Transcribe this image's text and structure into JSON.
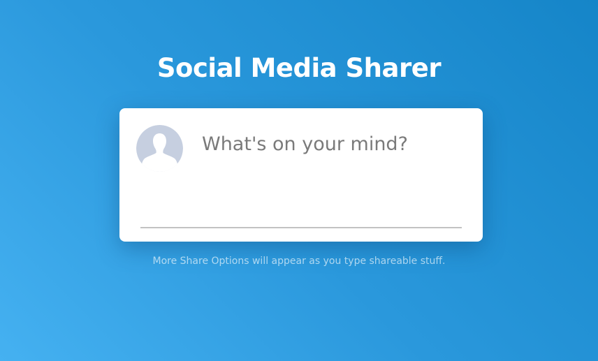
{
  "header": {
    "title": "Social Media Sharer"
  },
  "composer": {
    "placeholder": "What's on your mind?",
    "value": "",
    "avatar_icon": "default-user-silhouette-icon"
  },
  "footer": {
    "hint": "More Share Options will appear as you type shareable stuff."
  },
  "colors": {
    "background_start": "#45b1f1",
    "background_end": "#1585c8",
    "card": "#ffffff",
    "title_text": "#ffffff",
    "avatar_bg": "#c6cfe0",
    "underline": "#c2c2c2"
  }
}
